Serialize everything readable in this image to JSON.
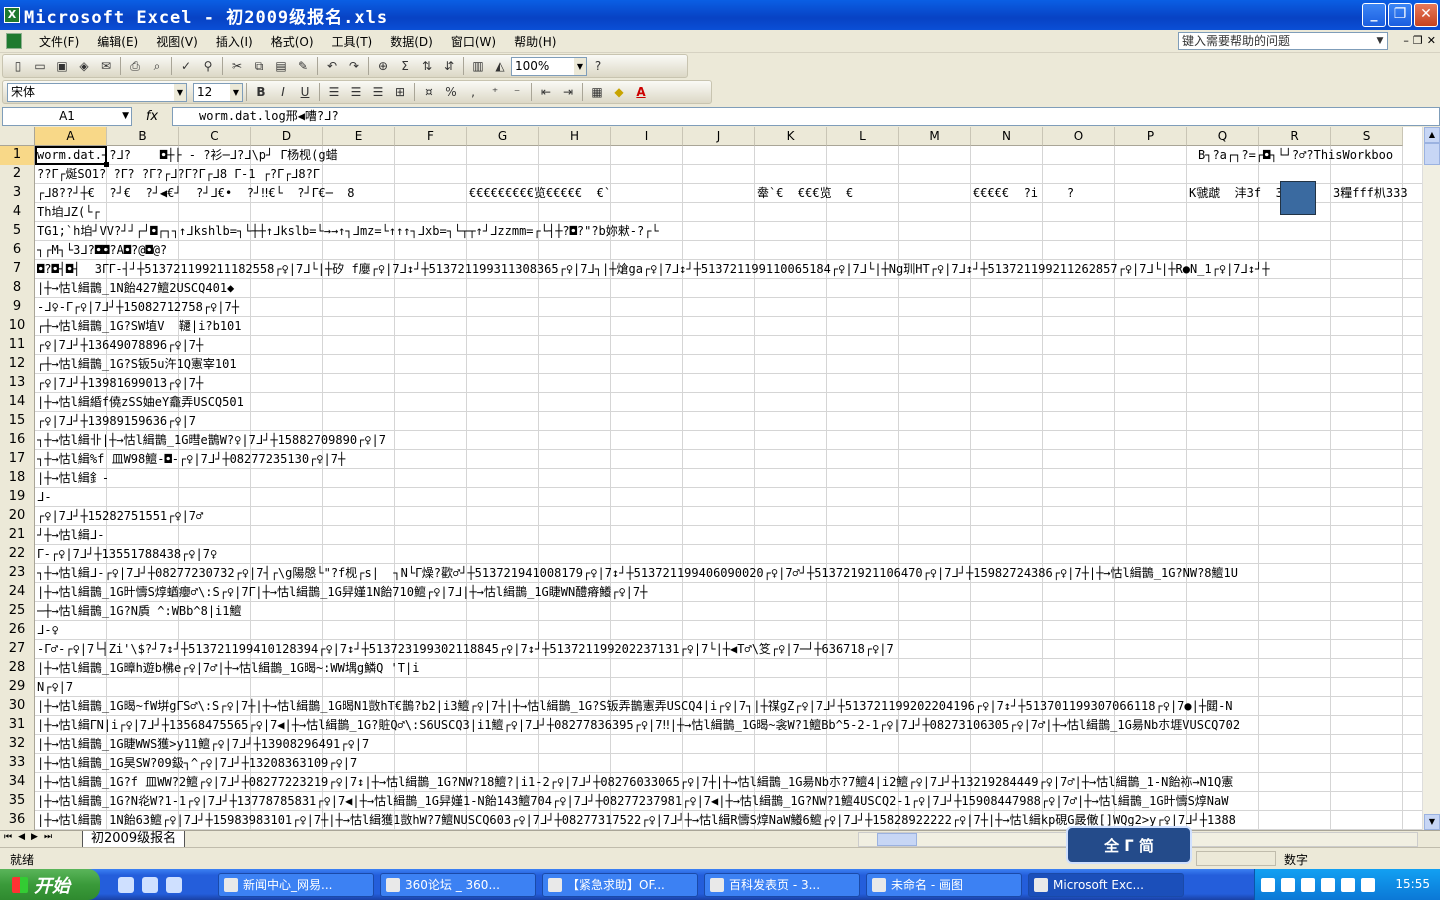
{
  "window": {
    "title": "Microsoft Excel - 初2009级报名.xls"
  },
  "menu": [
    "文件(F)",
    "编辑(E)",
    "视图(V)",
    "插入(I)",
    "格式(O)",
    "工具(T)",
    "数据(D)",
    "窗口(W)",
    "帮助(H)"
  ],
  "help": {
    "placeholder": "键入需要帮助的问题"
  },
  "toolbar": {
    "zoom": "100%",
    "font_name": "宋体",
    "font_size": "12",
    "sum_symbol": "Σ",
    "bold": "B",
    "italic": "I",
    "underline": "U",
    "percent": "%",
    "comma": ",",
    "font_color_label": "A"
  },
  "formula": {
    "cell": "A1",
    "fx": "fx",
    "content": "worm.dat.log邢◀嘈?ᒧ?"
  },
  "columns": [
    "A",
    "B",
    "C",
    "D",
    "E",
    "F",
    "G",
    "H",
    "I",
    "J",
    "K",
    "L",
    "M",
    "N",
    "O",
    "P",
    "Q",
    "R",
    "S"
  ],
  "rows": [
    {
      "n": "1",
      "text": "worm.dat.┘?ᒧ?    ◘┼├ - ?衫─ᒧ?ᒧ\\p┘ ᒥ杨枧(g蜡"
    },
    {
      "n": "2",
      "text": "??ᒥ┌烻SO1? ?ᒥ? ?ᒥ?┌ᒧ?ᒥ?ᒥ┌ᒧ8 ᒥ-1 ┌?ᒥ┌ᒧ8?ᒥ"
    },
    {
      "n": "3",
      "text": "┌ᒧ8??┘┼€  ?┘€  ?┘◀€┘  ?┘ᒧ€•  ?┘‼€└  ?┘ᒥ€─  8"
    },
    {
      "n": "4",
      "text": "Th垍ᒧZ(└┌"
    },
    {
      "n": "5",
      "text": "TG1;`h垍┘VV?┘┘┌┘◘┌┐┐↑ᒧkshlb=┐└┼┼↑ᒧkslb=└→→↑┐ᒧmz=└↑↑↑┐ᒧxb=┐└┬┬↑┘ᒧzzmm=┌└┤┼?◘?\"?b妳猌-?┌└"
    },
    {
      "n": "6",
      "text": "┐┌M┐└3ᒧ?◘◘?A◘?@◘@?"
    },
    {
      "n": "7",
      "text": "◘?◘┤◘┤  3ᒥᒥ-┤┘┼513721199211182558┌♀|7ᒧ└|┼矽 f廮┌♀|7ᒧ↕┘┼513721199311308365┌♀|7ᒧ┐|┼熗ga┌♀|7ᒧ↕┘┼513721199110065184┌♀|7ᒧ└|┼Ng玔HT┌♀|7ᒧ↕┘┼513721199211262857┌♀|7ᒧ└|┼R●N_1┌♀|7ᒧ↕┘┼"
    },
    {
      "n": "8",
      "text": "|┼→怙l緝鵲_1N飴427鱣2USCQ401◆"
    },
    {
      "n": "9",
      "text": "-ᒧ♀-ᒥ┌♀|7ᒧ┘┼15082712758┌♀|7┼"
    },
    {
      "n": "10",
      "text": "┌┼→怙l緝鵲_1G?SW埴V  韆|i?b101"
    },
    {
      "n": "11",
      "text": "┌♀|7ᒧ┘┼13649078896┌♀|7┼"
    },
    {
      "n": "12",
      "text": "┌┼→怙l緝鵲_1G?S钣5u汻1Q憲宰101"
    },
    {
      "n": "13",
      "text": "┌♀|7ᒧ┘┼13981699013┌♀|7┼"
    },
    {
      "n": "14",
      "text": "|┼→怙l緝緍f僥zSS妯eY龕弄USCQ501"
    },
    {
      "n": "15",
      "text": "┌♀|7ᒧ┘┼13989159636┌♀|7"
    },
    {
      "n": "16",
      "text": "┐┼→怙l緝卝|┼→怙l緝鵲_1G暳e鵲W?♀|7ᒧ┘┼15882709890┌♀|7"
    },
    {
      "n": "17",
      "text": "┐┼→怙l緝%f 皿W98鱣-◘-┌♀|7ᒧ┘┼08277235130┌♀|7┼"
    },
    {
      "n": "18",
      "text": "|┼→怙l緝釒-"
    },
    {
      "n": "19",
      "text": "ᒧ-"
    },
    {
      "n": "20",
      "text": "┌♀|7ᒧ┘┼15282751551┌♀|7♂"
    },
    {
      "n": "21",
      "text": "┘┼→怙l緝ᒧ-"
    },
    {
      "n": "22",
      "text": "ᒥ-┌♀|7ᒧ┘┼13551788438┌♀|7♀"
    },
    {
      "n": "23",
      "text": "┐┼→怙l緝ᒧ-┌♀|7ᒧ┘┼08277230732┌♀|7┤┌\\g陽慇└\"?f枧┌s|  ┐N└ᒥ燥?歡♂┘┼513721941008179┌♀|7↕┘┼513721199406090020┌♀|7♂┘┼513721921106470┌♀|7ᒧ┘┼15982724386┌♀|7┼|┼→怙l緝鵲_1G?NW?8鱣1U"
    },
    {
      "n": "24",
      "text": "|┼→怙l緝鵲_1G旪懤S焞蝤癭♂\\:S┌♀|7ᒥ|┼→怙l緝鵲_1G舁嫤1N飴710鱣┌♀|7ᒧ|┼→怙l緝鵲_1G睫WN醴瘠鱶┌♀|7┼"
    },
    {
      "n": "25",
      "text": "─┼→怙l緝鵲_1G?N貭 ^:WBb^8|i1鱣"
    },
    {
      "n": "26",
      "text": "ᒧ-♀"
    },
    {
      "n": "27",
      "text": "-ᒥ♂-┌♀|7└┤Zi'\\$?┘7↕┘┼513721199410128394┌♀|7↕┘┼513723199302118845┌♀|7↕┘┼513721199202237131┌♀|7└|┼◀T♂\\笅┌♀|7─┘┼636718┌♀|7"
    },
    {
      "n": "28",
      "text": "|┼→怙l緝鵲_1G暲h遊b梻e┌♀|7♂|┼→怙l緝鵲_1G暍~:WW堣g鱗Q 'T|i"
    },
    {
      "n": "29",
      "text": "N┌♀|7"
    },
    {
      "n": "30",
      "text": "|┼→怙l緝鵲_1G暍~fW垪gᒥS♂\\:S┌♀|7┼|┼→怙l緝鵲_1G暍N1敳hT€鵲?b2|i3鱣┌♀|7┼|┼→怙l緝鵲_1G?S钣弄鵲憲弄USCQ4|i┌♀|7┐|┼禖gZ┌♀|7ᒧ┘┼513721199202204196┌♀|7↕┘┼513701199307066118┌♀|7●|┼閮-N"
    },
    {
      "n": "31",
      "text": "|┼→怙l緝ᒥN|i┌♀|7ᒧ┘┼13568475565┌♀|7◀|┼→怙l緝鵲_1G?賍Q♂\\:S6USCQ3|i1鱣┌♀|7ᒧ┘┼08277836395┌♀|7‼|┼→怙l緝鵲_1G暍~衾W?1鱣Bb^5-2-1┌♀|7ᒧ┘┼08273106305┌♀|7♂|┼→怙l緝鵲_1G昜Nb朩堐VUSCQ702"
    },
    {
      "n": "32",
      "text": "|┼→怙l緝鵲_1G睫WWS獲>y11鱣┌♀|7ᒧ┘┼13908296491┌♀|7"
    },
    {
      "n": "33",
      "text": "|┼→怙l緝鵲_1G昊SW?09鈒┐^┌♀|7ᒧ┘┼13208363109┌♀|7"
    },
    {
      "n": "34",
      "text": "|┼→怙l緝鵲_1G?f 皿WW?2鱣┌♀|7ᒧ┘┼08277223219┌♀|7↕|┼→怙l緝鵲_1G?NW?18鱣?|i1-2┌♀|7ᒧ┘┼08276033065┌♀|7┼|┼→怙l緝鵲_1G昜Nb朩?7鱣4|i2鱣┌♀|7ᒧ┘┼13219284449┌♀|7♂|┼→怙l緝鵲_1-N飴袮→N1Q憲"
    },
    {
      "n": "35",
      "text": "|┼→怙l緝鵲_1G?N炛W?1-1┌♀|7ᒧ┘┼13778785831┌♀|7◀|┼→怙l緝鵲_1G舁嫤1-N飴143鱣704┌♀|7ᒧ┘┼08277237981┌♀|7◀|┼→怙l緝鵲_1G?NW?1鱣4USCQ2-1┌♀|7ᒧ┘┼15908447988┌♀|7♂|┼→怙l緝鵲_1G旪懤S焞NaW"
    },
    {
      "n": "36",
      "text": "|┼→怙l緝鵲 1N飴63鱣┌♀|7ᒧ┘┼15983983101┌♀|7┼|┼→怙l緝獲1敳hW?7鱣NUSCQ603┌♀|7ᒧ┘┼08277317522┌♀|7ᒧ┘┼→怙l緝R懤S焞NaW鱶6鱣┌♀|7ᒧ┘┼15828922222┌♀|7┼|┼→怙l緝kp硯G晸僌[]WQg2>y┌♀|7ᒧ┘┼1388"
    }
  ],
  "row1_right": "B┐?a┌┐?=┌◘┐└┘?♂?ThisWorkboo",
  "row3_segments": [
    {
      "col": "G",
      "text": "€€€€€€€€€览€€€€€  €`"
    },
    {
      "col": "K",
      "text": "舝`€  €€€览  €"
    },
    {
      "col": "N",
      "text": "€€€€€  ?i    ?"
    },
    {
      "col": "Q",
      "text": "K虢虣  沣3f  3烫"
    },
    {
      "col": "S",
      "text": "3糧fff朳333"
    }
  ],
  "sheet_tab": "初2009级报名",
  "status": {
    "left": "就绪",
    "right": "数字"
  },
  "ime": {
    "label": "全 ᒥ 简"
  },
  "taskbar": {
    "start": "开始",
    "tasks": [
      "新闻中心_网易...",
      "360论坛 _ 360...",
      "【紧急求助】OF...",
      "百科发表页 - 3...",
      "未命名 - 画图",
      "Microsoft Exc..."
    ],
    "clock": "15:55"
  }
}
